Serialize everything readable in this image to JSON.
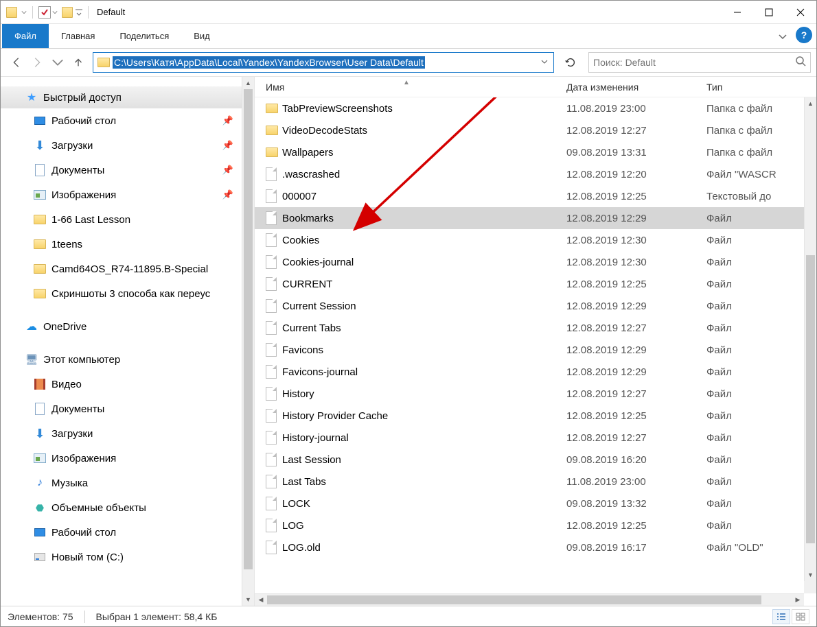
{
  "window": {
    "title": "Default"
  },
  "ribbon": {
    "file": "Файл",
    "home": "Главная",
    "share": "Поделиться",
    "view": "Вид"
  },
  "nav": {
    "path": "C:\\Users\\Катя\\AppData\\Local\\Yandex\\YandexBrowser\\User Data\\Default",
    "search_placeholder": "Поиск: Default"
  },
  "sidebar": {
    "quick": "Быстрый доступ",
    "items1": [
      {
        "label": "Рабочий стол",
        "pin": true,
        "icon": "desk"
      },
      {
        "label": "Загрузки",
        "pin": true,
        "icon": "dl"
      },
      {
        "label": "Документы",
        "pin": true,
        "icon": "doc"
      },
      {
        "label": "Изображения",
        "pin": true,
        "icon": "pic"
      },
      {
        "label": "1-66 Last Lesson",
        "pin": false,
        "icon": "fold"
      },
      {
        "label": "1teens",
        "pin": false,
        "icon": "fold"
      },
      {
        "label": "Camd64OS_R74-11895.B-Special",
        "pin": false,
        "icon": "fold"
      },
      {
        "label": "Скриншоты 3 способа как переус",
        "pin": false,
        "icon": "fold"
      }
    ],
    "onedrive": "OneDrive",
    "thispc": "Этот компьютер",
    "items2": [
      {
        "label": "Видео",
        "icon": "vid"
      },
      {
        "label": "Документы",
        "icon": "doc"
      },
      {
        "label": "Загрузки",
        "icon": "dl"
      },
      {
        "label": "Изображения",
        "icon": "pic"
      },
      {
        "label": "Музыка",
        "icon": "music"
      },
      {
        "label": "Объемные объекты",
        "icon": "obj3d"
      },
      {
        "label": "Рабочий стол",
        "icon": "desk"
      },
      {
        "label": "Новый том (C:)",
        "icon": "disk"
      }
    ]
  },
  "columns": {
    "name": "Имя",
    "date": "Дата изменения",
    "type": "Тип"
  },
  "files": [
    {
      "name": "TabPreviewScreenshots",
      "date": "11.08.2019 23:00",
      "type": "Папка с файл",
      "kind": "folder"
    },
    {
      "name": "VideoDecodeStats",
      "date": "12.08.2019 12:27",
      "type": "Папка с файл",
      "kind": "folder"
    },
    {
      "name": "Wallpapers",
      "date": "09.08.2019 13:31",
      "type": "Папка с файл",
      "kind": "folder"
    },
    {
      "name": ".wascrashed",
      "date": "12.08.2019 12:20",
      "type": "Файл \"WASCR",
      "kind": "file"
    },
    {
      "name": "000007",
      "date": "12.08.2019 12:25",
      "type": "Текстовый до",
      "kind": "file"
    },
    {
      "name": "Bookmarks",
      "date": "12.08.2019 12:29",
      "type": "Файл",
      "kind": "file",
      "selected": true
    },
    {
      "name": "Cookies",
      "date": "12.08.2019 12:30",
      "type": "Файл",
      "kind": "file"
    },
    {
      "name": "Cookies-journal",
      "date": "12.08.2019 12:30",
      "type": "Файл",
      "kind": "file"
    },
    {
      "name": "CURRENT",
      "date": "12.08.2019 12:25",
      "type": "Файл",
      "kind": "file"
    },
    {
      "name": "Current Session",
      "date": "12.08.2019 12:29",
      "type": "Файл",
      "kind": "file"
    },
    {
      "name": "Current Tabs",
      "date": "12.08.2019 12:27",
      "type": "Файл",
      "kind": "file"
    },
    {
      "name": "Favicons",
      "date": "12.08.2019 12:29",
      "type": "Файл",
      "kind": "file"
    },
    {
      "name": "Favicons-journal",
      "date": "12.08.2019 12:29",
      "type": "Файл",
      "kind": "file"
    },
    {
      "name": "History",
      "date": "12.08.2019 12:27",
      "type": "Файл",
      "kind": "file"
    },
    {
      "name": "History Provider Cache",
      "date": "12.08.2019 12:25",
      "type": "Файл",
      "kind": "file"
    },
    {
      "name": "History-journal",
      "date": "12.08.2019 12:27",
      "type": "Файл",
      "kind": "file"
    },
    {
      "name": "Last Session",
      "date": "09.08.2019 16:20",
      "type": "Файл",
      "kind": "file"
    },
    {
      "name": "Last Tabs",
      "date": "11.08.2019 23:00",
      "type": "Файл",
      "kind": "file"
    },
    {
      "name": "LOCK",
      "date": "09.08.2019 13:32",
      "type": "Файл",
      "kind": "file"
    },
    {
      "name": "LOG",
      "date": "12.08.2019 12:25",
      "type": "Файл",
      "kind": "file"
    },
    {
      "name": "LOG.old",
      "date": "09.08.2019 16:17",
      "type": "Файл \"OLD\"",
      "kind": "file"
    }
  ],
  "status": {
    "count_label": "Элементов: 75",
    "selected_label": "Выбран 1 элемент: 58,4 КБ"
  }
}
